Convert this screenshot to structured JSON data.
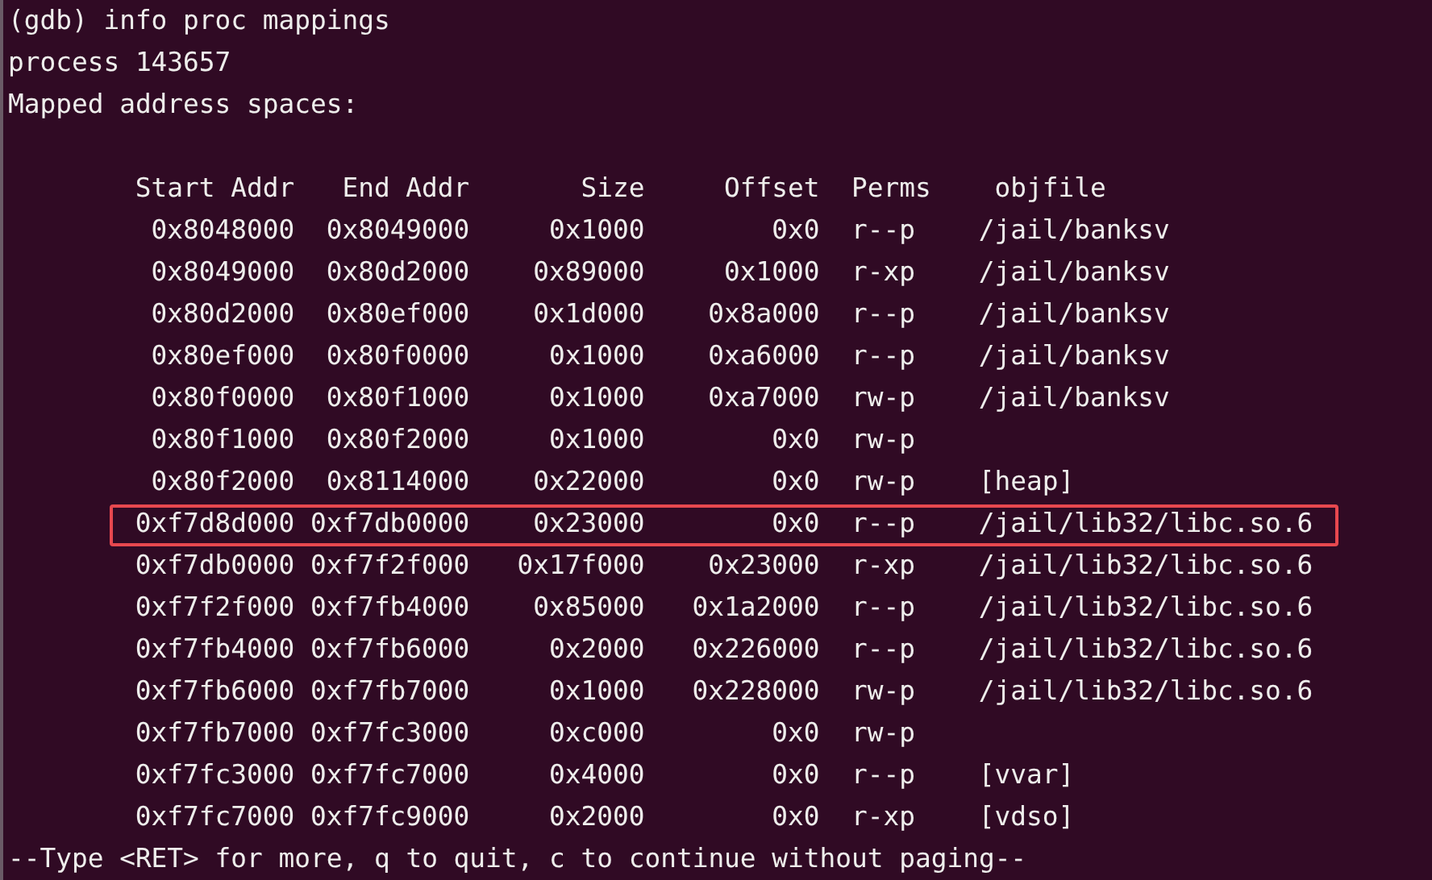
{
  "terminal": {
    "lines_before": [
      "(gdb) info proc mappings",
      "process 143657",
      "Mapped address spaces:"
    ],
    "table": {
      "columns": [
        "Start Addr",
        "End Addr",
        "Size",
        "Offset",
        "Perms",
        "objfile"
      ],
      "rows": [
        {
          "cells": [
            "0x8048000",
            "0x8049000",
            "0x1000",
            "0x0",
            "r--p",
            "/jail/banksv"
          ],
          "highlighted": false
        },
        {
          "cells": [
            "0x8049000",
            "0x80d2000",
            "0x89000",
            "0x1000",
            "r-xp",
            "/jail/banksv"
          ],
          "highlighted": false
        },
        {
          "cells": [
            "0x80d2000",
            "0x80ef000",
            "0x1d000",
            "0x8a000",
            "r--p",
            "/jail/banksv"
          ],
          "highlighted": false
        },
        {
          "cells": [
            "0x80ef000",
            "0x80f0000",
            "0x1000",
            "0xa6000",
            "r--p",
            "/jail/banksv"
          ],
          "highlighted": false
        },
        {
          "cells": [
            "0x80f0000",
            "0x80f1000",
            "0x1000",
            "0xa7000",
            "rw-p",
            "/jail/banksv"
          ],
          "highlighted": false
        },
        {
          "cells": [
            "0x80f1000",
            "0x80f2000",
            "0x1000",
            "0x0",
            "rw-p"
          ],
          "highlighted": false
        },
        {
          "cells": [
            "0x80f2000",
            "0x8114000",
            "0x22000",
            "0x0",
            "rw-p",
            "[heap]"
          ],
          "highlighted": false
        },
        {
          "cells": [
            "0xf7d8d000",
            "0xf7db0000",
            "0x23000",
            "0x0",
            "r--p",
            "/jail/lib32/libc.so.6"
          ],
          "highlighted": true
        },
        {
          "cells": [
            "0xf7db0000",
            "0xf7f2f000",
            "0x17f000",
            "0x23000",
            "r-xp",
            "/jail/lib32/libc.so.6"
          ],
          "highlighted": false
        },
        {
          "cells": [
            "0xf7f2f000",
            "0xf7fb4000",
            "0x85000",
            "0x1a2000",
            "r--p",
            "/jail/lib32/libc.so.6"
          ],
          "highlighted": false
        },
        {
          "cells": [
            "0xf7fb4000",
            "0xf7fb6000",
            "0x2000",
            "0x226000",
            "r--p",
            "/jail/lib32/libc.so.6"
          ],
          "highlighted": false
        },
        {
          "cells": [
            "0xf7fb6000",
            "0xf7fb7000",
            "0x1000",
            "0x228000",
            "rw-p",
            "/jail/lib32/libc.so.6"
          ],
          "highlighted": false
        },
        {
          "cells": [
            "0xf7fb7000",
            "0xf7fc3000",
            "0xc000",
            "0x0",
            "rw-p"
          ],
          "highlighted": false
        },
        {
          "cells": [
            "0xf7fc3000",
            "0xf7fc7000",
            "0x4000",
            "0x0",
            "r--p",
            "[vvar]"
          ],
          "highlighted": false
        },
        {
          "cells": [
            "0xf7fc7000",
            "0xf7fc9000",
            "0x2000",
            "0x0",
            "r-xp",
            "[vdso]"
          ],
          "highlighted": false
        }
      ]
    },
    "pager_prompt": "--Type <RET> for more, q to quit, c to continue without paging--"
  }
}
